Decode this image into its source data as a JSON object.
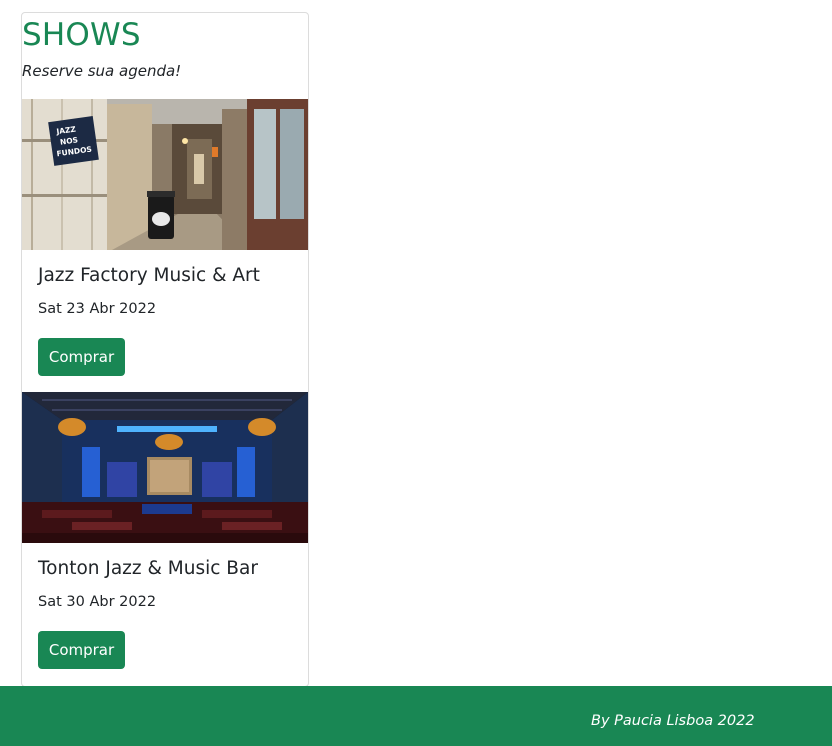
{
  "header": {
    "title": "SHOWS",
    "subtitle": "Reserve sua agenda!"
  },
  "events": [
    {
      "name": "Jazz Factory Music & Art",
      "date": "Sat 23 Abr 2022",
      "button_label": "Comprar",
      "image_sign": [
        "JAZZ",
        "NOS",
        "FUNDOS"
      ]
    },
    {
      "name": "Tonton Jazz & Music Bar",
      "date": "Sat 30 Abr 2022",
      "button_label": "Comprar"
    }
  ],
  "footer": {
    "text": "By Paucia Lisboa 2022"
  },
  "colors": {
    "brand": "#198754",
    "text": "#212529",
    "border": "#dcdcdc"
  }
}
